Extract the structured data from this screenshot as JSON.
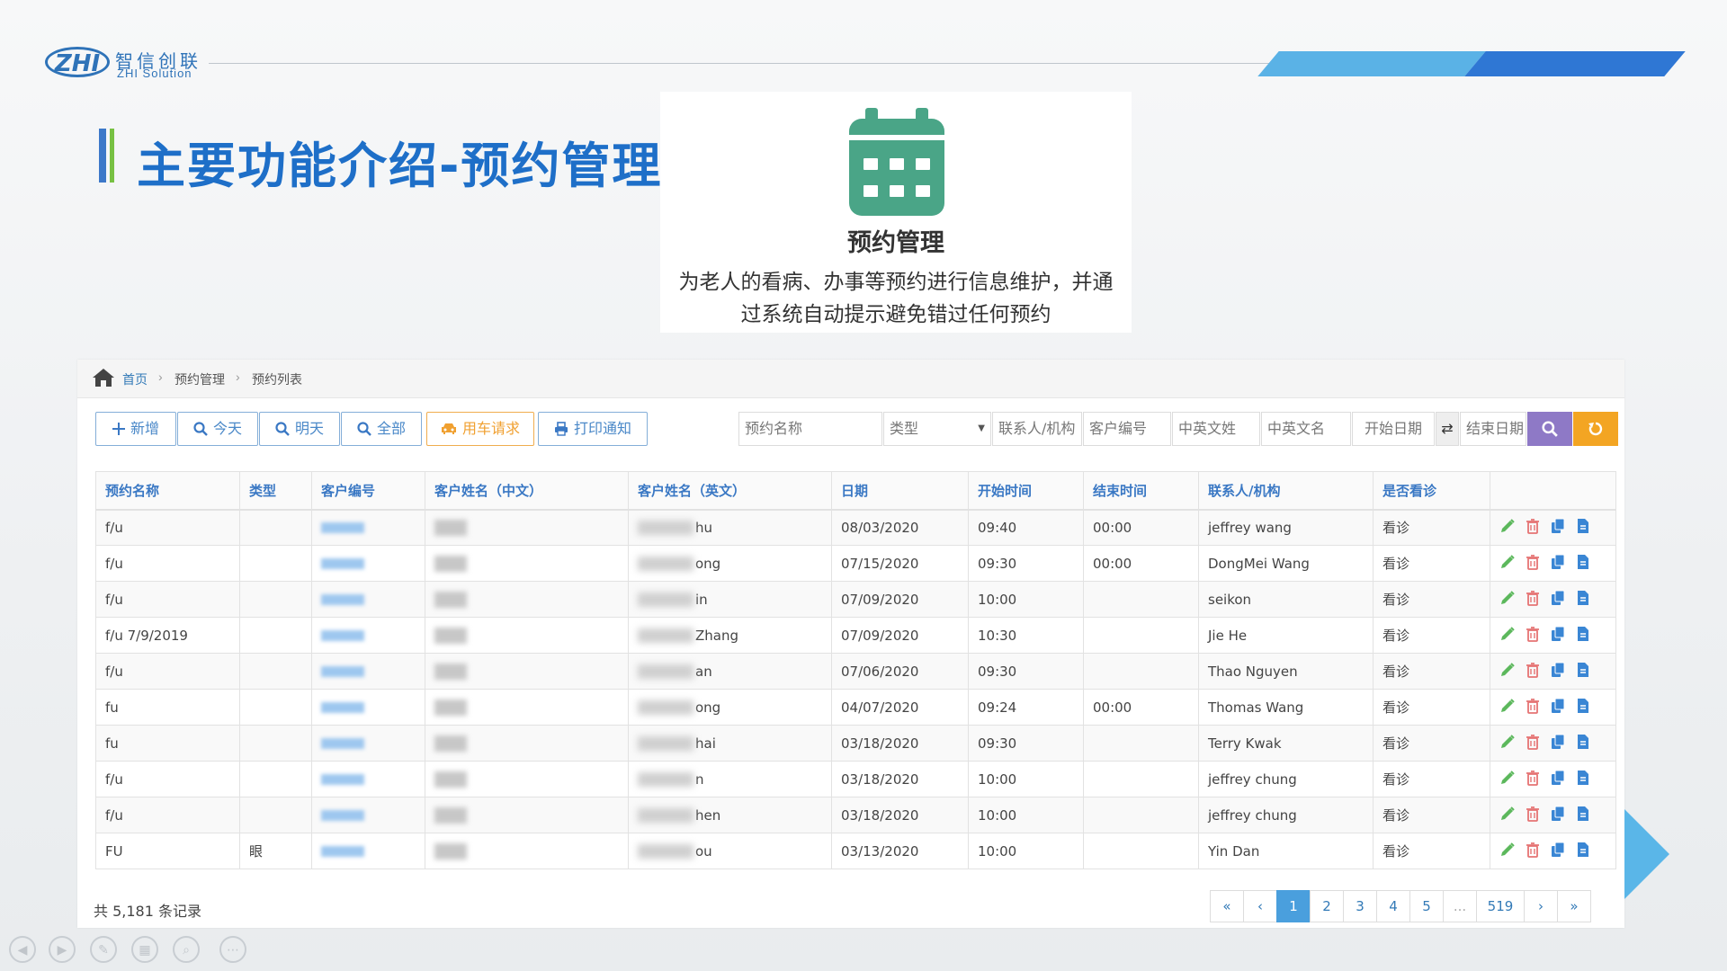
{
  "header": {
    "logo_mark": "ZHI",
    "logo_cn": "智信创联",
    "logo_en": "ZHI Solution",
    "page_title": "主要功能介绍-预约管理"
  },
  "feature_card": {
    "icon": "calendar-icon",
    "title": "预约管理",
    "desc_line1": "为老人的看病、办事等预约进行信息维护，并通",
    "desc_line2": "过系统自动提示避免错过任何预约"
  },
  "breadcrumb": [
    "首页",
    "预约管理",
    "预约列表"
  ],
  "toolbar": {
    "add": "新增",
    "today": "今天",
    "tomorrow": "明天",
    "all": "全部",
    "car_request": "用车请求",
    "print_notice": "打印通知"
  },
  "search": {
    "name_placeholder": "预约名称",
    "type_placeholder": "类型",
    "contact_placeholder": "联系人/机构",
    "customer_no_placeholder": "客户编号",
    "cn_name_placeholder": "中英文姓",
    "en_name_placeholder": "中英文名",
    "start_date_placeholder": "开始日期",
    "end_date_placeholder": "结束日期"
  },
  "table": {
    "headers": [
      "预约名称",
      "类型",
      "客户编号",
      "客户姓名（中文）",
      "客户姓名（英文）",
      "日期",
      "开始时间",
      "结束时间",
      "联系人/机构",
      "是否看诊",
      ""
    ],
    "rows": [
      {
        "name": "f/u",
        "type": "",
        "en_suffix": "hu",
        "date": "08/03/2020",
        "start": "09:40",
        "end": "00:00",
        "contact": "jeffrey wang",
        "visit": "看诊"
      },
      {
        "name": "f/u",
        "type": "",
        "en_suffix": "ong",
        "date": "07/15/2020",
        "start": "09:30",
        "end": "00:00",
        "contact": "DongMei Wang",
        "visit": "看诊"
      },
      {
        "name": "f/u",
        "type": "",
        "en_suffix": "in",
        "date": "07/09/2020",
        "start": "10:00",
        "end": "",
        "contact": "seikon",
        "visit": "看诊"
      },
      {
        "name": "f/u 7/9/2019",
        "type": "",
        "en_suffix": "Zhang",
        "date": "07/09/2020",
        "start": "10:30",
        "end": "",
        "contact": "Jie He",
        "visit": "看诊"
      },
      {
        "name": "f/u",
        "type": "",
        "en_suffix": "an",
        "date": "07/06/2020",
        "start": "09:30",
        "end": "",
        "contact": "Thao Nguyen",
        "visit": "看诊"
      },
      {
        "name": "fu",
        "type": "",
        "en_suffix": "ong",
        "date": "04/07/2020",
        "start": "09:24",
        "end": "00:00",
        "contact": "Thomas Wang",
        "visit": "看诊"
      },
      {
        "name": "fu",
        "type": "",
        "en_suffix": "hai",
        "date": "03/18/2020",
        "start": "09:30",
        "end": "",
        "contact": "Terry Kwak",
        "visit": "看诊"
      },
      {
        "name": "f/u",
        "type": "",
        "en_suffix": "n",
        "date": "03/18/2020",
        "start": "10:00",
        "end": "",
        "contact": "jeffrey chung",
        "visit": "看诊"
      },
      {
        "name": "f/u",
        "type": "",
        "en_suffix": "hen",
        "date": "03/18/2020",
        "start": "10:00",
        "end": "",
        "contact": "jeffrey chung",
        "visit": "看诊"
      },
      {
        "name": "FU",
        "type": "眼",
        "en_suffix": "ou",
        "date": "03/13/2020",
        "start": "10:00",
        "end": "",
        "contact": "Yin Dan",
        "visit": "看诊"
      }
    ],
    "row_actions": [
      "edit-icon",
      "delete-icon",
      "copy-icon",
      "document-icon"
    ]
  },
  "footer": {
    "total_text": "共 5,181 条记录",
    "pages": [
      "«",
      "‹",
      "1",
      "2",
      "3",
      "4",
      "5",
      "...",
      "519",
      "›",
      "»"
    ],
    "active_page": "1"
  },
  "colors": {
    "brand_blue": "#1e6fc8",
    "calendar_green": "#4aa587",
    "search_purple": "#8e79c6",
    "reset_orange": "#f3a523",
    "edit_green": "#5cb85c",
    "delete_red": "#e57373",
    "copy_blue": "#3a86d4"
  }
}
